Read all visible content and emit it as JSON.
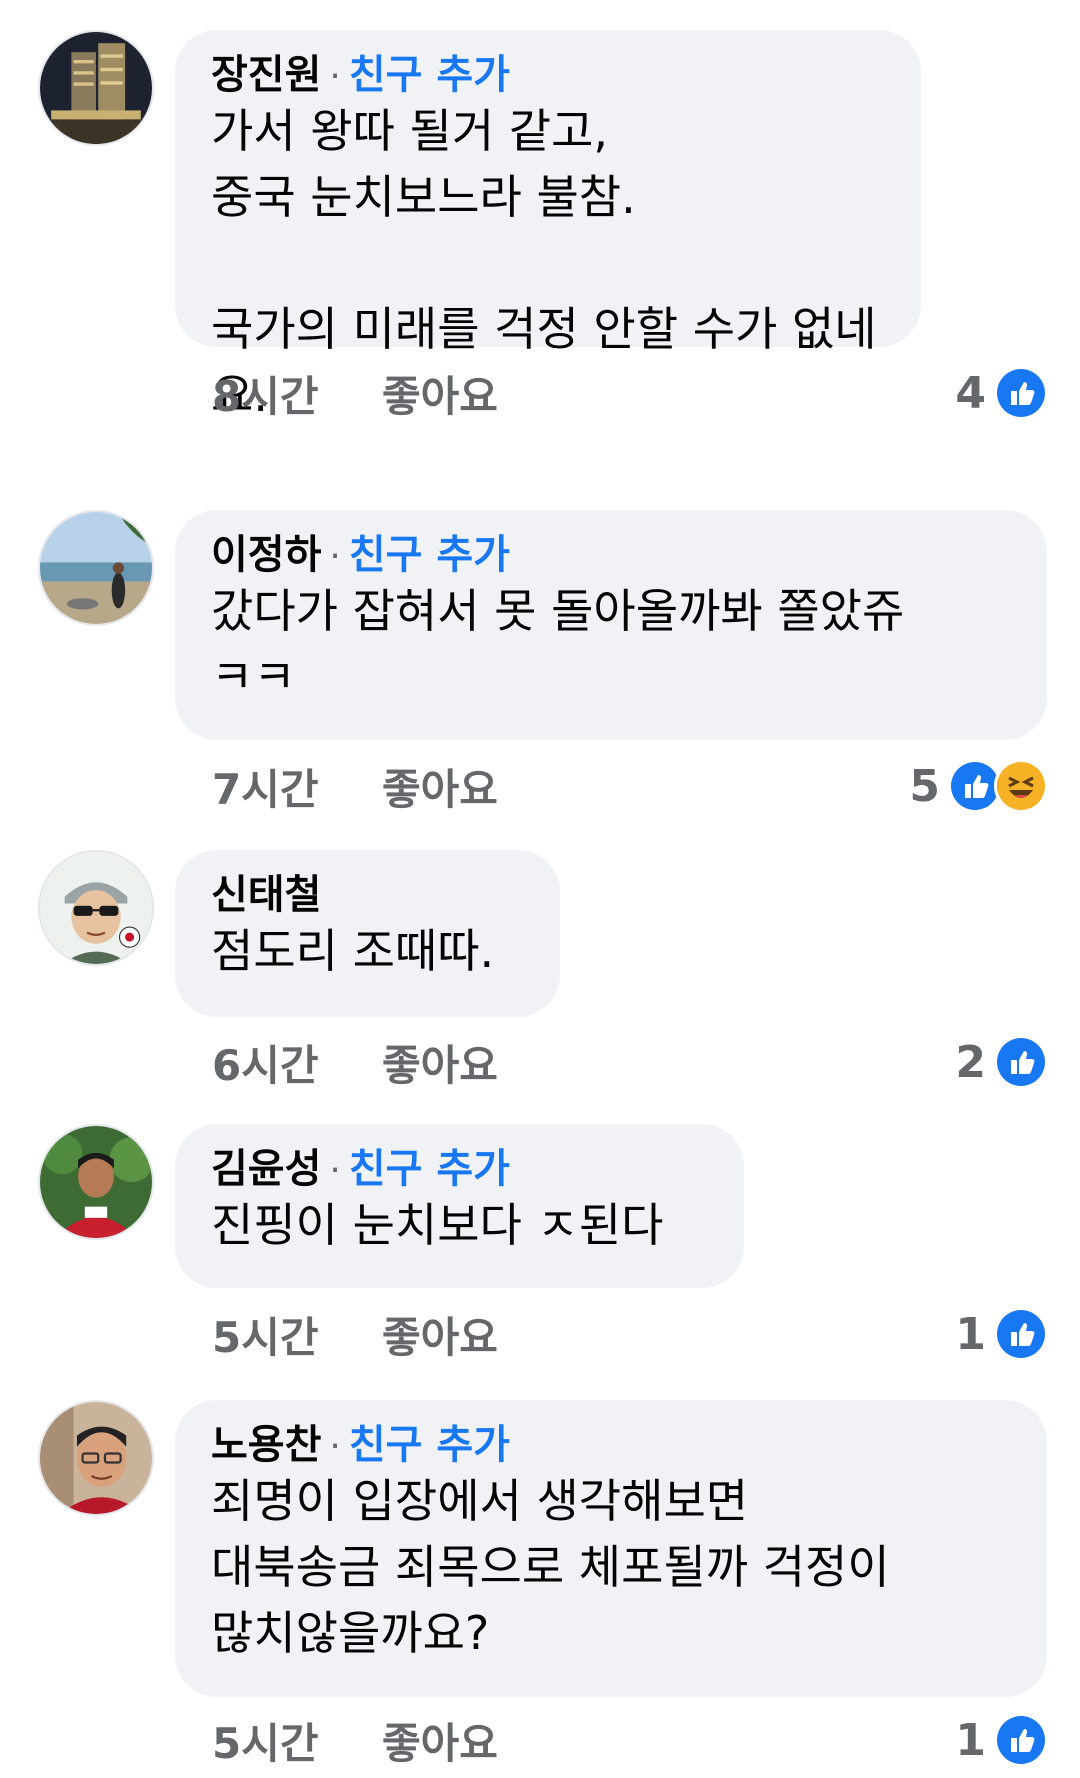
{
  "comments": [
    {
      "name": "장진원",
      "add_friend": "친구 추가",
      "text": "가서 왕따 될거 같고,\n중국 눈치보느라 불참.\n\n국가의 미래를 걱정 안할 수가 없네요.",
      "time": "8시간",
      "like_label": "좋아요",
      "reaction_count": "4",
      "reactions": [
        "like-icon"
      ]
    },
    {
      "name": "이정하",
      "add_friend": "친구 추가",
      "text": "갔다가 잡혀서 못 돌아올까봐 쫄았쥬\nㅋㅋ",
      "time": "7시간",
      "like_label": "좋아요",
      "reaction_count": "5",
      "reactions": [
        "like-icon",
        "haha-icon"
      ]
    },
    {
      "name": "신태철",
      "add_friend": "",
      "text": "점도리 조때따.",
      "time": "6시간",
      "like_label": "좋아요",
      "reaction_count": "2",
      "reactions": [
        "like-icon"
      ]
    },
    {
      "name": "김윤성",
      "add_friend": "친구 추가",
      "text": "진핑이 눈치보다 ㅈ된다",
      "time": "5시간",
      "like_label": "좋아요",
      "reaction_count": "1",
      "reactions": [
        "like-icon"
      ]
    },
    {
      "name": "노용찬",
      "add_friend": "친구 추가",
      "text": "죄명이 입장에서 생각해보면\n대북송금 죄목으로 체포될까 걱정이\n많치않을까요?",
      "time": "5시간",
      "like_label": "좋아요",
      "reaction_count": "1",
      "reactions": [
        "like-icon"
      ]
    }
  ],
  "colors": {
    "bubble": "#f0f2f5",
    "link": "#1877f2",
    "meta": "#65676b",
    "like_blue": "#1877f2",
    "haha_yellow": "#f7b125"
  }
}
